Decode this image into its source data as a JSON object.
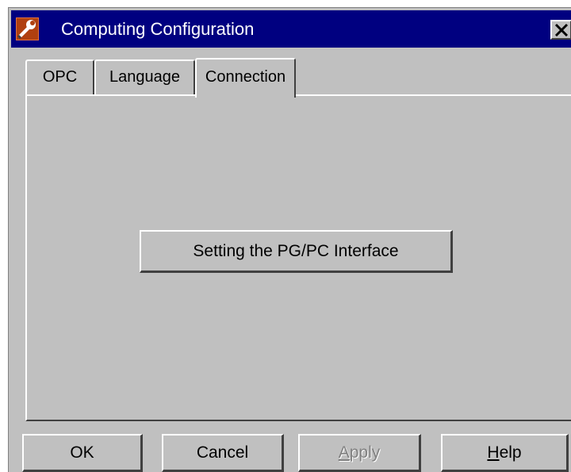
{
  "window": {
    "title": "Computing Configuration",
    "icon": "wrench-tool-icon",
    "close_icon": "close-x-icon"
  },
  "tabs": [
    {
      "label": "OPC",
      "active": false
    },
    {
      "label": "Language",
      "active": false
    },
    {
      "label": "Connection",
      "active": true
    }
  ],
  "panel": {
    "setting_button_label": "Setting the PG/PC Interface"
  },
  "footer": {
    "ok_label": "OK",
    "cancel_label": "Cancel",
    "apply": {
      "mnemonic": "A",
      "rest": "pply",
      "enabled": false
    },
    "help": {
      "mnemonic": "H",
      "rest": "elp",
      "enabled": true
    }
  },
  "colors": {
    "titlebar": "#000080",
    "face": "#c0c0c0",
    "disabled_text": "#808080"
  }
}
